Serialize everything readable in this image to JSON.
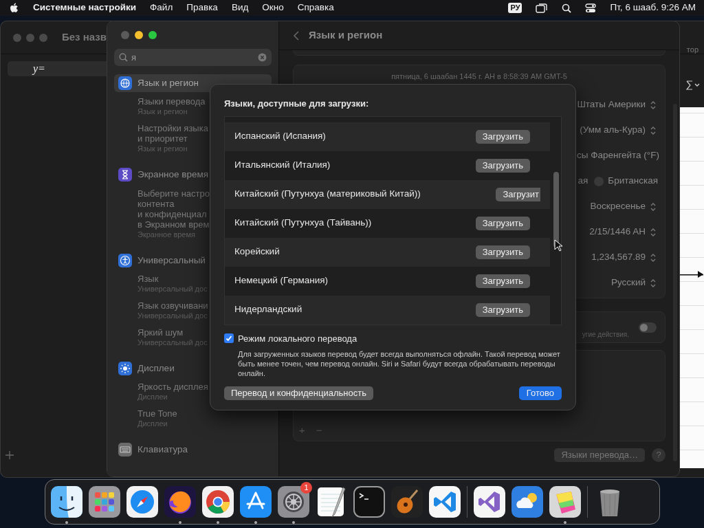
{
  "menu_bar": {
    "app_name": "Системные настройки",
    "menus": [
      "Файл",
      "Правка",
      "Вид",
      "Окно",
      "Справка"
    ],
    "input_source": "РУ",
    "clock": "Пт, 6 шааб. 9:26 AM"
  },
  "grapher_window": {
    "title": "Без назв",
    "toolbar_label": "тор",
    "equation": "y="
  },
  "settings_window": {
    "search": {
      "value": "я"
    },
    "sidebar": [
      {
        "title": "Язык и регион",
        "color": "#2f6fd6",
        "selected": true,
        "children": [
          {
            "title": "Языки перевода",
            "subtitle": "Язык и регион"
          },
          {
            "title": "Настройки языка\nи приоритет",
            "subtitle": "Язык и регион"
          }
        ]
      },
      {
        "title": "Экранное время",
        "color": "#5b4bc4",
        "selected": false,
        "children": [
          {
            "title": "Выберите настро\nконтента\nи конфиденциал\nв Экранном врем",
            "subtitle": "Экранное время"
          }
        ]
      },
      {
        "title": "Универсальный",
        "color": "#2f6fd6",
        "selected": false,
        "children": [
          {
            "title": "Язык",
            "subtitle": "Универсальный дос"
          },
          {
            "title": "Язык озвучивани",
            "subtitle": "Универсальный дос"
          },
          {
            "title": "Яркий шум",
            "subtitle": "Универсальный дос"
          }
        ]
      },
      {
        "title": "Дисплеи",
        "color": "#2f6fd6",
        "selected": false,
        "children": [
          {
            "title": "Яркость дисплея",
            "subtitle": "Дисплеи"
          },
          {
            "title": "True Tone",
            "subtitle": "Дисплеи"
          }
        ]
      },
      {
        "title": "Клавиатура",
        "color": "#6b6b6b",
        "selected": false
      }
    ],
    "header": {
      "title": "Язык и регион"
    },
    "date_preview": "пятница, 6 шаабан 1445 г. AH в 8:58:39 AM GMT-5",
    "rows": [
      {
        "kind": "popup",
        "value": "Штаты Америки"
      },
      {
        "kind": "popup",
        "value": "(Умм аль-Кура)"
      },
      {
        "kind": "text",
        "value": "сы Фаренгейта (°F)"
      },
      {
        "kind": "radio",
        "value": "ая",
        "option": "Британская",
        "selected": false
      },
      {
        "kind": "popup",
        "value": "Воскресенье"
      },
      {
        "kind": "popup",
        "value": "2/15/1446 AH"
      },
      {
        "kind": "popup",
        "value": "1,234,567.89"
      },
      {
        "kind": "popup",
        "value": "Русский"
      }
    ],
    "toggle_row": {
      "caption": "угие действия.",
      "on": false
    },
    "list_controls": [
      "+",
      "−"
    ],
    "bottom_button": "Языки перевода…",
    "help": "?"
  },
  "dialog": {
    "title": "Языки, доступные для загрузки:",
    "languages": [
      {
        "name": "Испанский (Испания)",
        "button": "Загрузить"
      },
      {
        "name": "Итальянский (Италия)",
        "button": "Загрузить"
      },
      {
        "name": "Китайский (Путунхуа (материковый Китай))",
        "button": "Загрузит",
        "cut": true
      },
      {
        "name": "Китайский (Путунхуа (Тайвань))",
        "button": "Загрузить"
      },
      {
        "name": "Корейский",
        "button": "Загрузить"
      },
      {
        "name": "Немецкий (Германия)",
        "button": "Загрузить"
      },
      {
        "name": "Нидерландский",
        "button": "Загрузить"
      }
    ],
    "local_mode": {
      "label": "Режим локального перевода",
      "checked": true,
      "description": "Для загруженных языков перевод будет всегда выполняться офлайн. Такой перевод может быть менее точен, чем перевод онлайн. Siri и Safari будут всегда обрабатывать переводы онлайн."
    },
    "buttons": [
      {
        "label": "Перевод и конфиденциальность",
        "primary": false
      },
      {
        "label": "Готово",
        "primary": true
      }
    ]
  },
  "dock": {
    "items": [
      {
        "kind": "app",
        "running": true
      },
      {
        "kind": "app",
        "running": false
      },
      {
        "kind": "app",
        "running": false
      },
      {
        "kind": "app",
        "running": true
      },
      {
        "kind": "app",
        "running": true
      },
      {
        "kind": "app",
        "running": true
      },
      {
        "kind": "app",
        "running": true,
        "badge": "1"
      },
      {
        "kind": "app",
        "running": false
      },
      {
        "kind": "app",
        "running": false
      },
      {
        "kind": "app",
        "running": false
      },
      {
        "kind": "app",
        "running": false
      },
      {
        "kind": "separator"
      },
      {
        "kind": "app",
        "running": false
      },
      {
        "kind": "app",
        "running": false
      },
      {
        "kind": "app",
        "running": true
      },
      {
        "kind": "separator"
      },
      {
        "kind": "trash"
      }
    ]
  }
}
